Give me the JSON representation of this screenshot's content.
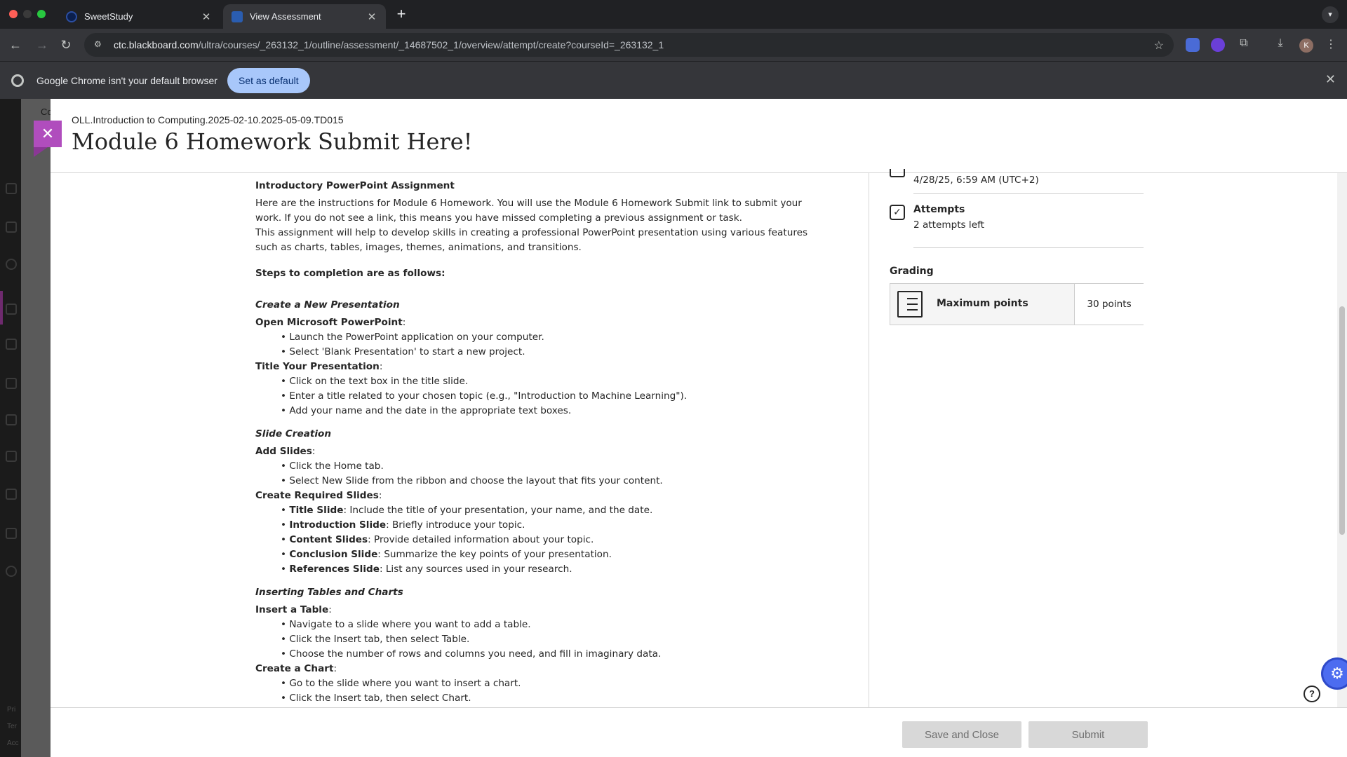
{
  "browser": {
    "tabs": [
      {
        "label": "SweetStudy",
        "active": false
      },
      {
        "label": "View Assessment",
        "active": true
      }
    ],
    "url_host": "ctc.blackboard.com",
    "url_path": "/ultra/courses/_263132_1/outline/assessment/_14687502_1/overview/attempt/create?courseId=_263132_1",
    "profile_initial": "K",
    "infobar": {
      "message": "Google Chrome isn't your default browser",
      "button": "Set as default"
    }
  },
  "panel": {
    "course": "OLL.Introduction to Computing.2025-02-10.2025-05-09.TD015",
    "title": "Module 6 Homework Submit Here!"
  },
  "document": {
    "heading": "Introductory PowerPoint Assignment",
    "intro1": "Here are the instructions for Module 6 Homework. You will use the Module 6 Homework Submit link to submit your work. If you do not see a link, this means you have missed completing a previous assignment or task.",
    "intro2": "This assignment will help to develop skills in creating a professional PowerPoint presentation using various features such as charts, tables, images, themes, animations, and transitions.",
    "steps_heading": "Steps to completion are as follows:",
    "sections": {
      "create": {
        "title": "Create a New Presentation",
        "open_label": "Open Microsoft PowerPoint",
        "open_items": [
          "Launch the PowerPoint application on your computer.",
          "Select 'Blank Presentation' to start a new project."
        ],
        "title_label": "Title Your Presentation",
        "title_items": [
          "Click on the text box in the title slide.",
          "Enter a title related to your chosen topic (e.g., \"Introduction to Machine Learning\").",
          "Add your name and the date in the appropriate text boxes."
        ]
      },
      "slides": {
        "title": "Slide Creation",
        "add_label": "Add Slides",
        "add_items": [
          "Click the Home tab.",
          "Select New Slide from the ribbon and choose the layout that fits your content."
        ],
        "req_label": "Create Required Slides",
        "req_items": [
          {
            "b": "Title Slide",
            "t": ": Include the title of your presentation, your name, and the date."
          },
          {
            "b": "Introduction Slide",
            "t": ": Briefly introduce your topic."
          },
          {
            "b": "Content Slides",
            "t": ": Provide detailed information about your topic."
          },
          {
            "b": "Conclusion Slide",
            "t": ": Summarize the key points of your presentation."
          },
          {
            "b": "References Slide",
            "t": ": List any sources used in your research."
          }
        ]
      },
      "tables": {
        "title": "Inserting Tables and Charts",
        "table_label": "Insert a Table",
        "table_items": [
          "Navigate to a slide where you want to add a table.",
          "Click the Insert tab, then select Table.",
          "Choose the number of rows and columns you need, and fill in imaginary data."
        ],
        "chart_label": "Create a Chart",
        "chart_items": [
          "Go to the slide where you want to insert a chart.",
          "Click the Insert tab, then select Chart."
        ]
      }
    }
  },
  "sidebar": {
    "due": "4/28/25, 6:59 AM (UTC+2)",
    "attempts_label": "Attempts",
    "attempts_value": "2 attempts left",
    "grading_label": "Grading",
    "max_points_label": "Maximum points",
    "max_points_value": "30 points"
  },
  "footer": {
    "save_close": "Save and Close",
    "submit": "Submit"
  },
  "background": {
    "peek_text": "Co",
    "footer_fragments": [
      "Pri",
      "Ter",
      "Acc"
    ]
  }
}
